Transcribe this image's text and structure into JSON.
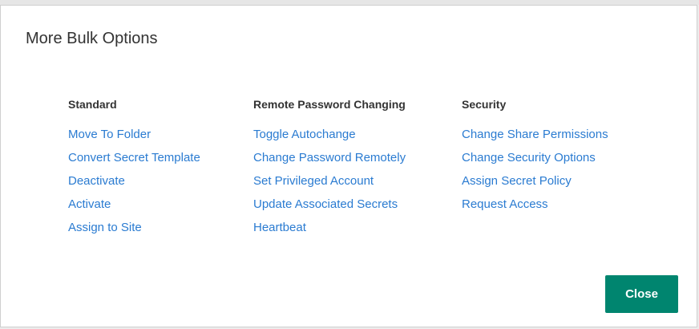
{
  "dialog": {
    "title": "More Bulk Options",
    "close_label": "Close",
    "accent_color": "#00856f",
    "link_color": "#2a7bd1"
  },
  "columns": [
    {
      "heading": "Standard",
      "links": [
        "Move To Folder",
        "Convert Secret Template",
        "Deactivate",
        "Activate",
        "Assign to Site"
      ]
    },
    {
      "heading": "Remote Password Changing",
      "links": [
        "Toggle Autochange",
        "Change Password Remotely",
        "Set Privileged Account",
        "Update Associated Secrets",
        "Heartbeat"
      ]
    },
    {
      "heading": "Security",
      "links": [
        "Change Share Permissions",
        "Change Security Options",
        "Assign Secret Policy",
        "Request Access"
      ]
    }
  ]
}
